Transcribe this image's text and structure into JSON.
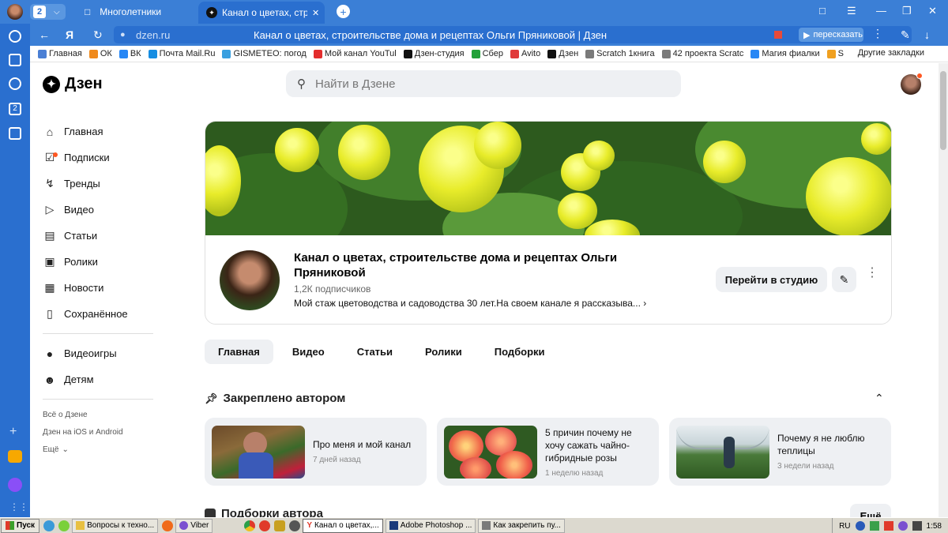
{
  "browser": {
    "tab_count": "2",
    "tabs": [
      {
        "title": "Многолетники"
      },
      {
        "title": "Канал о цветах, строит"
      }
    ],
    "address": {
      "domain": "dzen.ru",
      "page_title": "Канал о цветах, строительстве дома и рецептах Ольги Пряниковой | Дзен",
      "retell_label": "пересказать"
    },
    "bookmarks": [
      {
        "label": "Главная",
        "color": "#4a7fd4"
      },
      {
        "label": "ОК",
        "color": "#f08a1c"
      },
      {
        "label": "ВК",
        "color": "#2787f5"
      },
      {
        "label": "Почта Mail.Ru",
        "color": "#168de2"
      },
      {
        "label": "GISMETEO: погод",
        "color": "#3aa0e0"
      },
      {
        "label": "Мой канал YouTul",
        "color": "#e32d2d"
      },
      {
        "label": "Дзен-студия",
        "color": "#111111"
      },
      {
        "label": "Сбер",
        "color": "#21a038"
      },
      {
        "label": "Avito",
        "color": "#e03a3a"
      },
      {
        "label": "Дзен",
        "color": "#111111"
      },
      {
        "label": "Scratch 1книга",
        "color": "#7a7a7a"
      },
      {
        "label": "42 проекта Scratc",
        "color": "#7a7a7a"
      },
      {
        "label": "Магия фиалки",
        "color": "#2787f5"
      },
      {
        "label": "S",
        "color": "#f0a020"
      }
    ],
    "bookmarks_more": "Другие закладки"
  },
  "header": {
    "logo": "Дзен",
    "search_placeholder": "Найти в Дзене"
  },
  "sidebar": {
    "items": [
      {
        "label": "Главная",
        "icon": "home-icon"
      },
      {
        "label": "Подписки",
        "icon": "subscriptions-icon"
      },
      {
        "label": "Тренды",
        "icon": "lightning-icon"
      },
      {
        "label": "Видео",
        "icon": "video-icon"
      },
      {
        "label": "Статьи",
        "icon": "book-icon"
      },
      {
        "label": "Ролики",
        "icon": "shorts-icon"
      },
      {
        "label": "Новости",
        "icon": "news-icon"
      },
      {
        "label": "Сохранённое",
        "icon": "bookmark-icon"
      }
    ],
    "extra_items": [
      {
        "label": "Видеоигры",
        "icon": "gamepad-icon"
      },
      {
        "label": "Детям",
        "icon": "kids-icon"
      }
    ],
    "footer_links": [
      "Всё о Дзене",
      "Дзен на iOS и Android",
      "Ещё"
    ]
  },
  "channel": {
    "title": "Канал о цветах, строительстве дома и рецептах Ольги Пряниковой",
    "subscribers": "1,2К подписчиков",
    "description": "Мой стаж цветоводства и садоводства 30 лет.На своем канале я рассказыва...",
    "studio_button": "Перейти в студию"
  },
  "content_tabs": [
    "Главная",
    "Видео",
    "Статьи",
    "Ролики",
    "Подборки"
  ],
  "active_tab": "Главная",
  "pinned": {
    "heading": "Закреплено автором",
    "cards": [
      {
        "title": "Про меня и мой канал",
        "time": "7 дней назад"
      },
      {
        "title": "5 причин почему не хочу сажать чайно-гибридные розы",
        "time": "1 неделю назад"
      },
      {
        "title": "Почему я не люблю теплицы",
        "time": "3 недели назад"
      }
    ]
  },
  "selections": {
    "heading": "Подборки автора",
    "more_label": "Ещё"
  },
  "taskbar": {
    "start": "Пуск",
    "items": [
      {
        "label": "Вопросы к техно..."
      },
      {
        "label": "Viber"
      },
      {
        "label": "Канал о цветах,..."
      },
      {
        "label": "Adobe Photoshop ..."
      },
      {
        "label": "Как закрепить пу..."
      }
    ],
    "lang": "RU",
    "clock": "1:58"
  }
}
